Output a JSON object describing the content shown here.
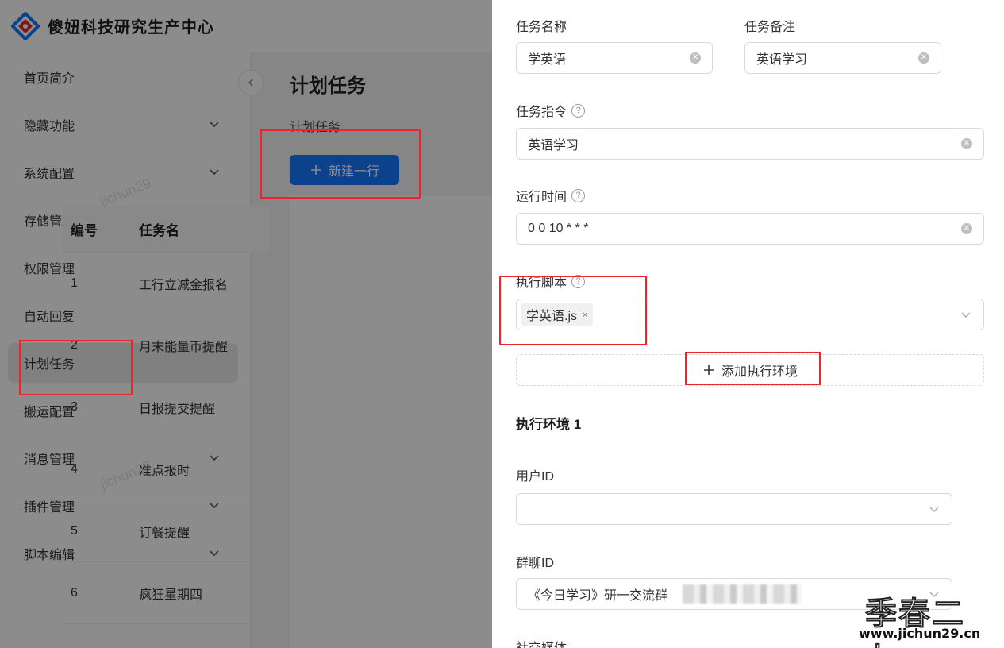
{
  "app": {
    "title": "傻妞科技研究生产中心"
  },
  "sidebar": {
    "items": [
      {
        "label": "首页简介",
        "has_children": false
      },
      {
        "label": "隐藏功能",
        "has_children": true
      },
      {
        "label": "系统配置",
        "has_children": true
      },
      {
        "label": "存储管理",
        "has_children": false
      },
      {
        "label": "权限管理",
        "has_children": false
      },
      {
        "label": "自动回复",
        "has_children": false
      },
      {
        "label": "计划任务",
        "has_children": false,
        "active": true
      },
      {
        "label": "搬运配置",
        "has_children": false
      },
      {
        "label": "消息管理",
        "has_children": true
      },
      {
        "label": "插件管理",
        "has_children": true
      },
      {
        "label": "脚本编辑",
        "has_children": true
      }
    ]
  },
  "main": {
    "page_title": "计划任务",
    "card_label": "计划任务",
    "new_row_label": "新建一行",
    "watermark": "jichun29",
    "table": {
      "headers": [
        "编号",
        "任务名"
      ],
      "rows": [
        {
          "id": "1",
          "name": "工行立减金报名"
        },
        {
          "id": "2",
          "name": "月末能量币提醒"
        },
        {
          "id": "3",
          "name": "日报提交提醒"
        },
        {
          "id": "4",
          "name": "准点报时"
        },
        {
          "id": "5",
          "name": "订餐提醒"
        },
        {
          "id": "6",
          "name": "疯狂星期四"
        }
      ]
    }
  },
  "drawer": {
    "task_name": {
      "label": "任务名称",
      "value": "学英语"
    },
    "task_note": {
      "label": "任务备注",
      "value": "英语学习"
    },
    "task_command": {
      "label": "任务指令",
      "value": "英语学习"
    },
    "run_time": {
      "label": "运行时间",
      "value": "0 0 10 * * *"
    },
    "exec_script": {
      "label": "执行脚本",
      "tag": "学英语.js"
    },
    "add_env_label": "添加执行环境",
    "env_heading": "执行环境 1",
    "user_id": {
      "label": "用户ID",
      "value": ""
    },
    "group_id": {
      "label": "群聊ID",
      "value": "《今日学习》研一交流群"
    },
    "social_media": {
      "label": "社交媒体"
    }
  },
  "site_mark": {
    "title": "季春二九",
    "url": "www.jichun29.cn"
  },
  "colors": {
    "primary": "#1677ff",
    "highlight": "#e8262b",
    "mask": "rgba(0,0,0,0.45)"
  },
  "icons": [
    "logo-icon",
    "chevron-down-icon",
    "chevron-left-icon",
    "plus-icon",
    "clear-icon",
    "help-icon",
    "tag-close-icon"
  ]
}
